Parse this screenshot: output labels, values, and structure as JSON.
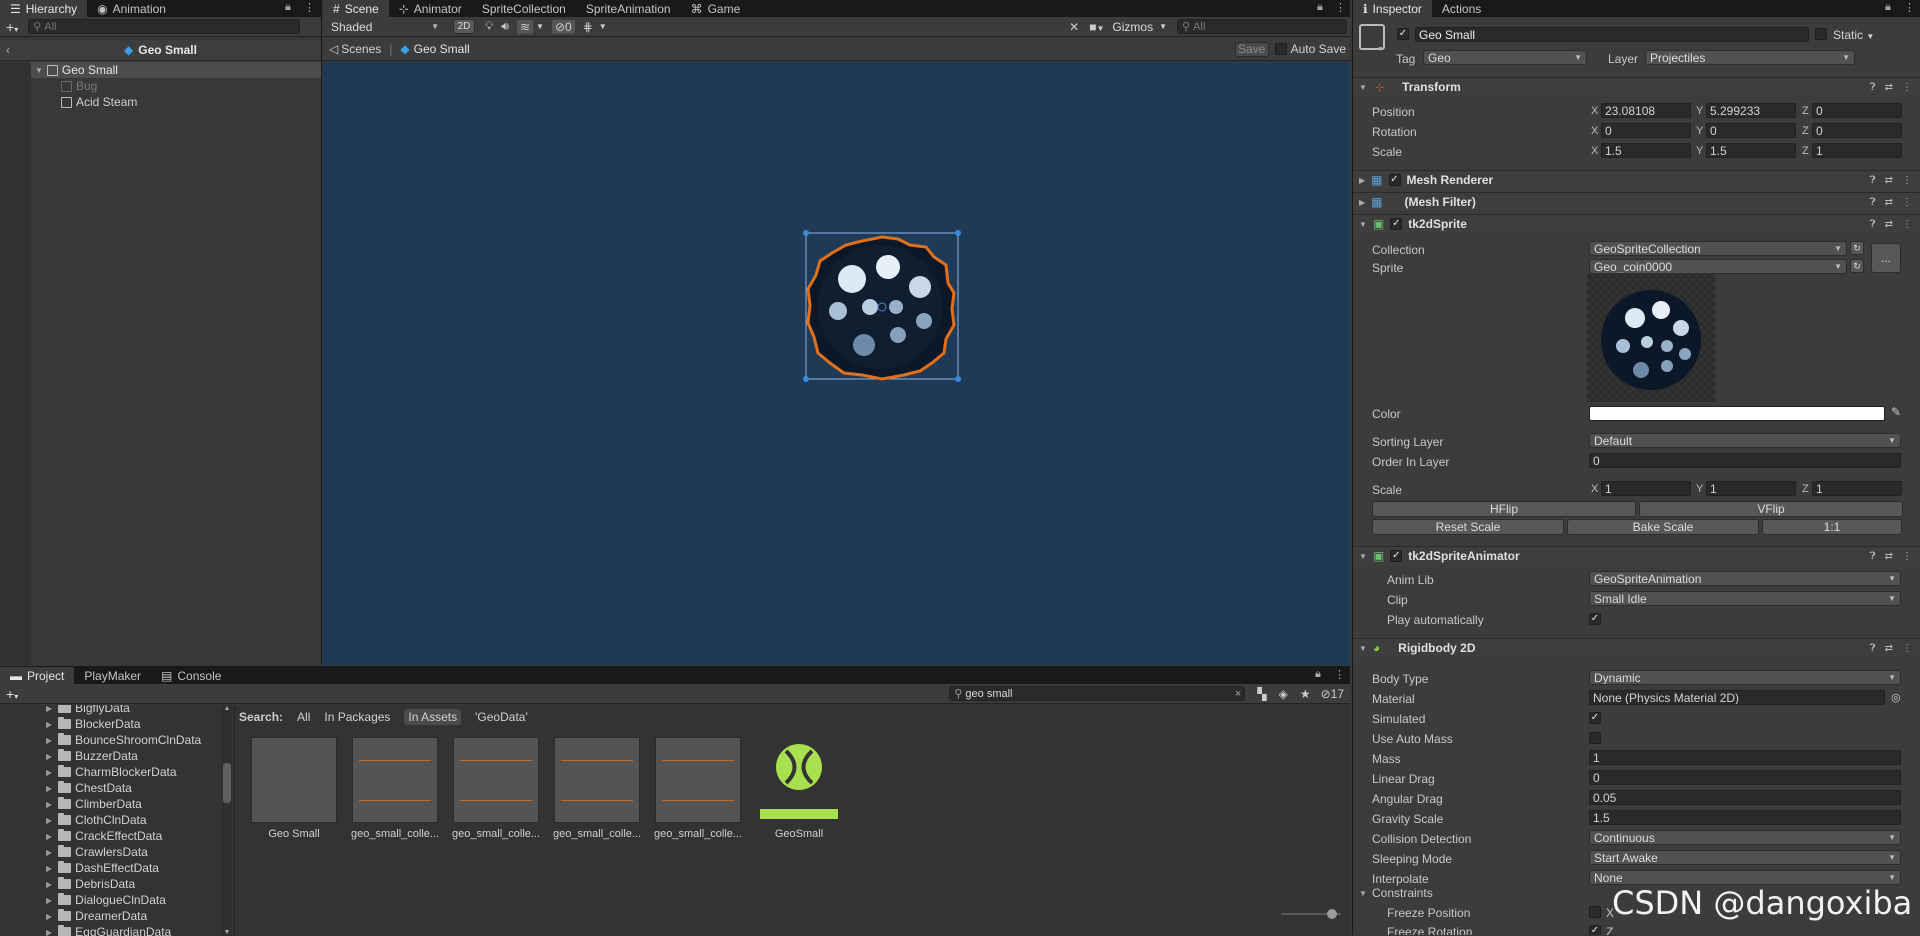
{
  "hierarchy": {
    "tabs": [
      "Hierarchy",
      "Animation"
    ],
    "search_placeholder": "All",
    "scene_title": "Geo Small",
    "items": [
      {
        "label": "Geo Small",
        "depth": 0,
        "selected": true
      },
      {
        "label": "Bug",
        "depth": 1,
        "disabled": true
      },
      {
        "label": "Acid Steam",
        "depth": 1
      }
    ]
  },
  "scene": {
    "tabs": [
      "Scene",
      "Animator",
      "SpriteCollection",
      "SpriteAnimation",
      "Game"
    ],
    "shading": "Shaded",
    "mode_2d": "2D",
    "hidden_count": "0",
    "gizmos": "Gizmos",
    "search_placeholder": "All",
    "breadcrumb_root": "Scenes",
    "breadcrumb_current": "Geo Small",
    "save": "Save",
    "auto_save": "Auto Save",
    "background": "#1f3a57"
  },
  "project": {
    "tabs": [
      "Project",
      "PlayMaker",
      "Console"
    ],
    "search_value": "geo small",
    "count": "17",
    "search_label": "Search:",
    "scopes": [
      "All",
      "In Packages",
      "In Assets",
      "'GeoData'"
    ],
    "folders": [
      "BigflyData",
      "BlockerData",
      "BounceShroomClnData",
      "BuzzerData",
      "CharmBlockerData",
      "ChestData",
      "ClimberData",
      "ClothClnData",
      "CrackEffectData",
      "CrawlersData",
      "DashEffectData",
      "DebrisData",
      "DialogueClnData",
      "DreamerData",
      "EggGuardianData"
    ],
    "assets": [
      "Geo Small",
      "geo_small_colle...",
      "geo_small_colle...",
      "geo_small_colle...",
      "geo_small_colle...",
      "GeoSmall"
    ]
  },
  "inspector": {
    "tabs": [
      "Inspector",
      "Actions"
    ],
    "object_name": "Geo Small",
    "static": "Static",
    "tag_label": "Tag",
    "tag": "Geo",
    "layer_label": "Layer",
    "layer": "Projectiles",
    "transform": {
      "title": "Transform",
      "position_label": "Position",
      "position": [
        "23.08108",
        "5.299233",
        "0"
      ],
      "rotation_label": "Rotation",
      "rotation": [
        "0",
        "0",
        "0"
      ],
      "scale_label": "Scale",
      "scale": [
        "1.5",
        "1.5",
        "1"
      ]
    },
    "mesh_renderer": "Mesh Renderer",
    "mesh_filter": "(Mesh Filter)",
    "tk2d_sprite": {
      "title": "tk2dSprite",
      "collection_label": "Collection",
      "collection": "GeoSpriteCollection",
      "sprite_label": "Sprite",
      "sprite": "Geo_coin0000",
      "more": "...",
      "color_label": "Color",
      "sorting_layer_label": "Sorting Layer",
      "sorting_layer": "Default",
      "order_label": "Order In Layer",
      "order": "0",
      "scale_label": "Scale",
      "scale": [
        "1",
        "1",
        "1"
      ],
      "hflip": "HFlip",
      "vflip": "VFlip",
      "reset_scale": "Reset Scale",
      "bake_scale": "Bake Scale",
      "one_to_one": "1:1"
    },
    "tk2d_animator": {
      "title": "tk2dSpriteAnimator",
      "anim_lib_label": "Anim Lib",
      "anim_lib": "GeoSpriteAnimation",
      "clip_label": "Clip",
      "clip": "Small Idle",
      "play_auto_label": "Play automatically"
    },
    "rigidbody": {
      "title": "Rigidbody 2D",
      "body_type_label": "Body Type",
      "body_type": "Dynamic",
      "material_label": "Material",
      "material": "None (Physics Material 2D)",
      "simulated_label": "Simulated",
      "auto_mass_label": "Use Auto Mass",
      "mass_label": "Mass",
      "mass": "1",
      "linear_drag_label": "Linear Drag",
      "linear_drag": "0",
      "angular_drag_label": "Angular Drag",
      "angular_drag": "0.05",
      "gravity_label": "Gravity Scale",
      "gravity": "1.5",
      "collision_label": "Collision Detection",
      "collision": "Continuous",
      "sleeping_label": "Sleeping Mode",
      "sleeping": "Start Awake",
      "interpolate_label": "Interpolate",
      "interpolate": "None",
      "constraints_label": "Constraints",
      "freeze_pos_label": "Freeze Position",
      "freeze_pos_axis": "X",
      "freeze_rot_label": "Freeze Rotation",
      "freeze_rot_axis": "Z"
    }
  },
  "watermark": "CSDN @dangoxiba"
}
